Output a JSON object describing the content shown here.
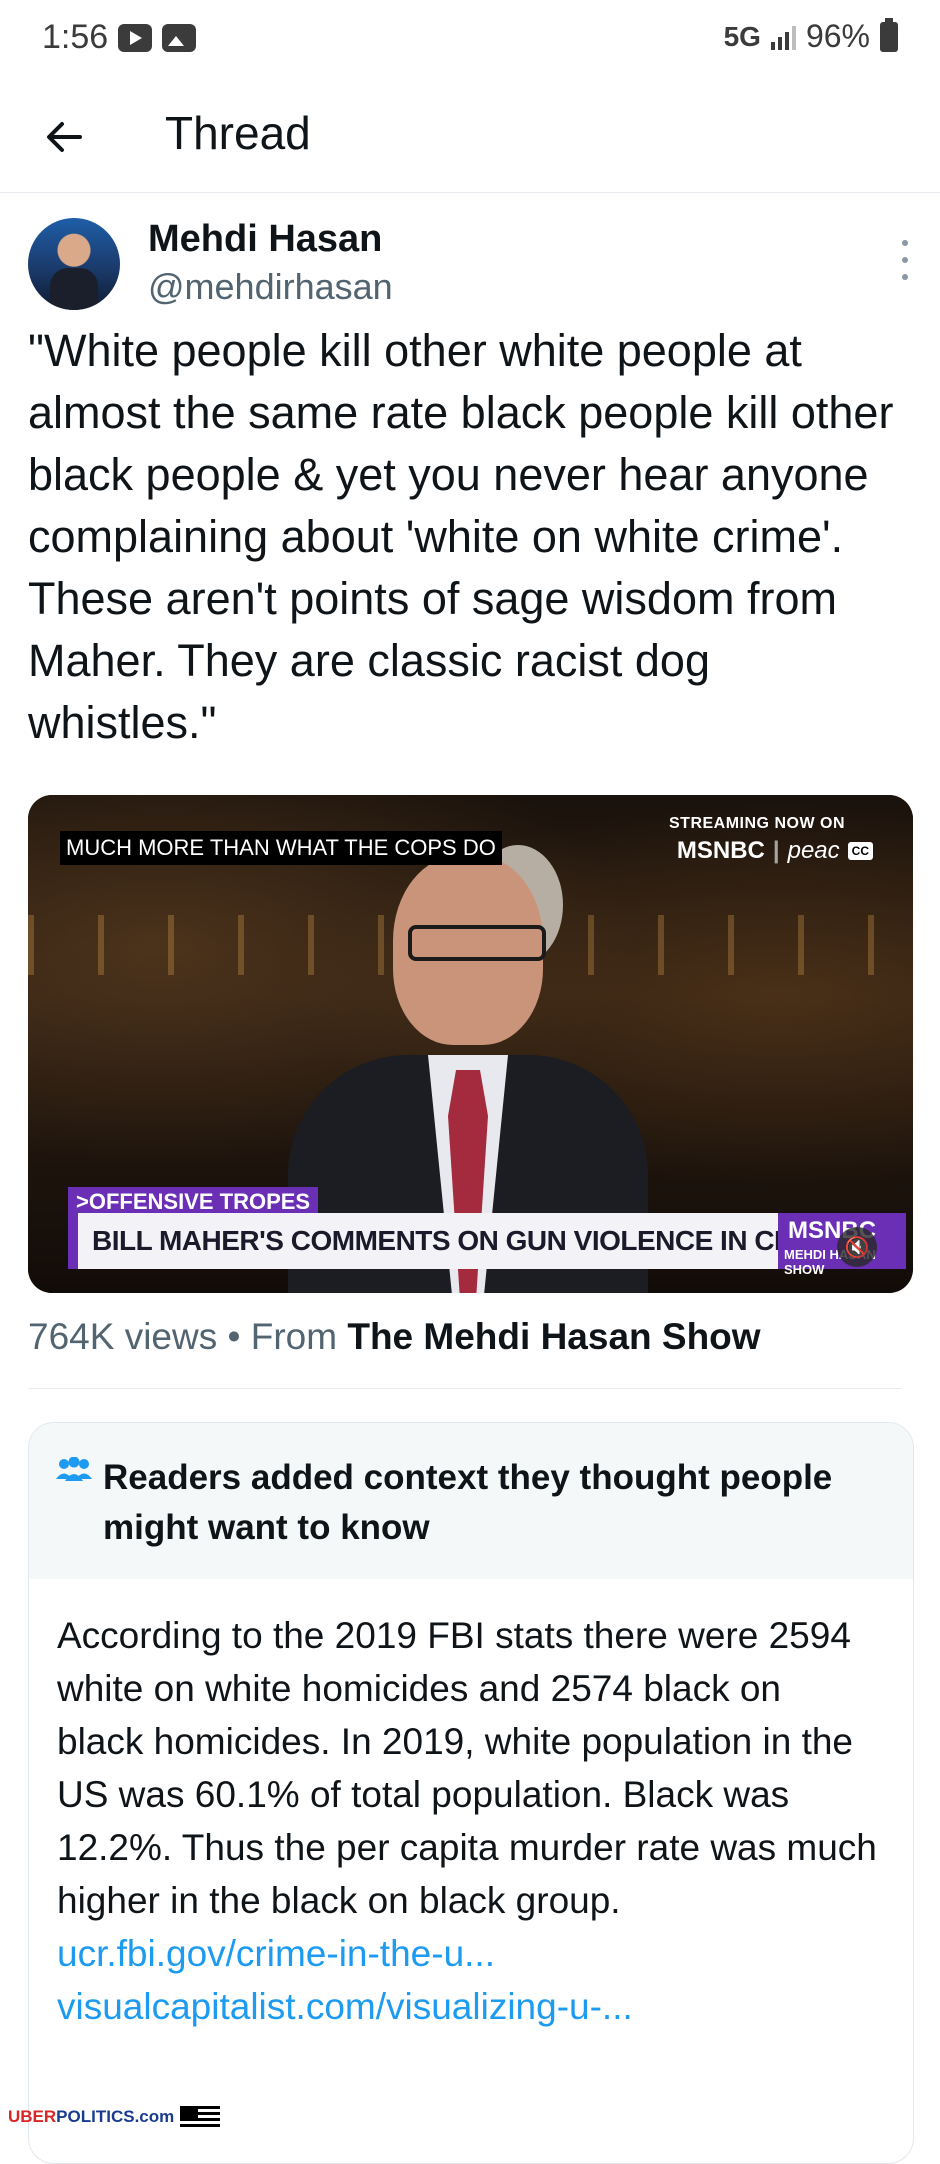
{
  "status_bar": {
    "time": "1:56",
    "network": "5G",
    "battery": "96%"
  },
  "header": {
    "title": "Thread"
  },
  "tweet": {
    "author_name": "Mehdi Hasan",
    "author_handle": "@mehdirhasan",
    "text": "\"White people kill other white people at almost the same rate black people kill other black people & yet you never hear anyone complaining about 'white on white crime'. These aren't points of sage wisdom from Maher. They are classic racist dog whistles.\""
  },
  "video": {
    "caption": "MUCH MORE THAN WHAT THE COPS DO",
    "streaming_label": "STREAMING NOW ON",
    "network_logo": "MSNBC",
    "partner_logo": "peac",
    "cc_badge": "CC",
    "lower_tag": ">OFFENSIVE TROPES",
    "lower_headline": "BILL MAHER'S COMMENTS ON GUN VIOLENCE IN CHICAGO",
    "lower_logo": "MSNBC",
    "lower_show": "MEHDI HASAN SHOW"
  },
  "meta": {
    "views": "764K views",
    "separator": " • From ",
    "source": "The Mehdi Hasan Show"
  },
  "community_note": {
    "title": "Readers added context they thought people might want to know",
    "body": "According to the 2019 FBI stats there were 2594 white on white homicides and 2574 black on black homicides. In 2019, white population in the US was 60.1% of total population. Black was 12.2%. Thus the per capita murder rate was much higher in the black on black group.",
    "link1": "ucr.fbi.gov/crime-in-the-u...",
    "link2": "visualcapitalist.com/visualizing-u-..."
  },
  "watermark": {
    "part1": "UBER",
    "part2": "POLITICS",
    "part3": ".com"
  },
  "colors": {
    "link": "#1d9bf0",
    "secondary_text": "#536471",
    "msnbc_purple": "#6a2fb5"
  }
}
